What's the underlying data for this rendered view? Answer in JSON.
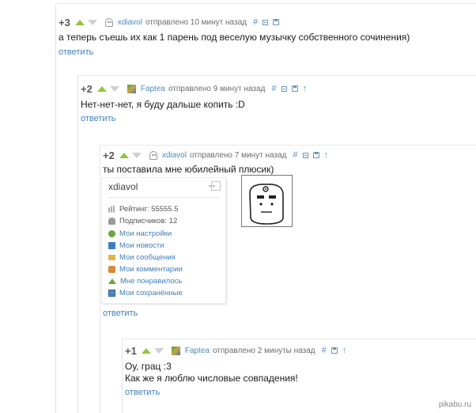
{
  "colors": {
    "author": "#4a8bc2",
    "vote_up": "#8fc640",
    "vote_down": "#cfcfcf",
    "link": "#3f7fbd"
  },
  "comments": [
    {
      "rating": "+3",
      "author": "xdiavol",
      "meta": "отправлено 10 минут назад",
      "lines": [
        "а теперь съешь их как 1 парень под веселую музычку собственного сочинения)"
      ],
      "reply": "ответить",
      "avatar": "ghost-avatar-icon"
    },
    {
      "rating": "+2",
      "author": "Faptea",
      "meta": "отправлено 9 минут назад",
      "lines": [
        "Нет-нет-нет, я буду дальше копить :D"
      ],
      "reply": "ответить",
      "avatar": "user-avatar-icon"
    },
    {
      "rating": "+2",
      "author": "xdiavol",
      "meta": "отправлено 7 минут назад",
      "lines": [
        "ты поставила мне юбилейный плюсик)"
      ],
      "reply": "ответить",
      "avatar": "ghost-avatar-icon"
    },
    {
      "rating": "+1",
      "author": "Faptea",
      "meta": "отправлено 2 минуты назад",
      "lines": [
        "Оу, грац :3",
        "Как же я люблю числовые совпадения!"
      ],
      "reply": "ответить",
      "avatar": "user-avatar-icon"
    }
  ],
  "actions": {
    "hash": "#",
    "up_arrow": "↑"
  },
  "profile_popup": {
    "username": "xdiavol",
    "rating": "Рейтинг: 55555.5",
    "subscribers": "Подписчиков: 12",
    "links": [
      {
        "label": "Мои настройки",
        "icon": "gear-icon"
      },
      {
        "label": "Мои новости",
        "icon": "news-icon"
      },
      {
        "label": "Мои сообщения",
        "icon": "mail-icon"
      },
      {
        "label": "Мои комментарии",
        "icon": "comment-icon"
      },
      {
        "label": "Мне понравилось",
        "icon": "like-icon"
      },
      {
        "label": "Мои сохранённые",
        "icon": "saved-icon"
      }
    ]
  },
  "watermark": "pikabu.ru"
}
